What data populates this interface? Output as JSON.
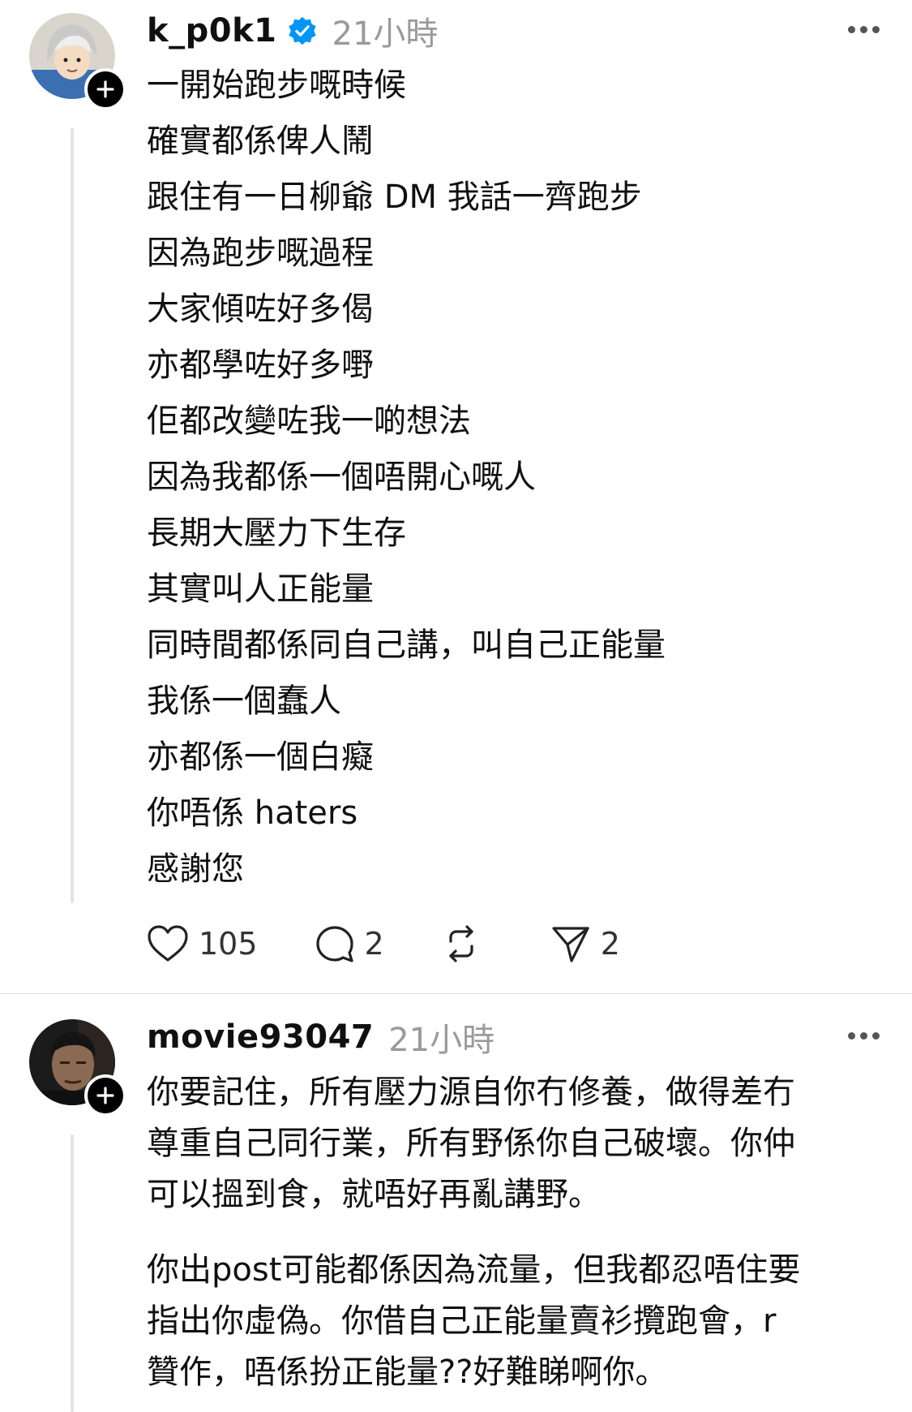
{
  "posts": [
    {
      "username": "k_p0k1",
      "verified": true,
      "time": "21小時",
      "lines": [
        "一開始跑步嘅時候",
        "確實都係俾人鬧",
        "跟住有一日柳爺 DM 我話一齊跑步",
        "因為跑步嘅過程",
        "大家傾咗好多偈",
        "亦都學咗好多嘢",
        "佢都改變咗我一啲想法",
        "因為我都係一個唔開心嘅人",
        "長期大壓力下生存",
        "其實叫人正能量",
        "同時間都係同自己講，叫自己正能量",
        "我係一個蠢人",
        "亦都係一個白癡",
        "你唔係 haters",
        "感謝您"
      ],
      "likes": "105",
      "replies": "2",
      "shares": "2"
    },
    {
      "username": "movie93047",
      "verified": false,
      "time": "21小時",
      "paragraphs": [
        [
          "你要記住，所有壓力源自你冇修養，做得差冇",
          "尊重自己同行業，所有野係你自己破壞。你仲",
          "可以搵到食，就唔好再亂講野。"
        ],
        [
          "你出post可能都係因為流量，但我都忍唔住要",
          "指出你虛偽。你借自己正能量賣衫攬跑會，r",
          "贊作，唔係扮正能量??好難睇啊你。"
        ]
      ]
    }
  ],
  "colors": {
    "text": "#101010",
    "muted": "#9a9a9a",
    "verified_blue": "#0095f6",
    "thread_line": "#e3e3e3"
  },
  "icons": [
    "follow-plus-icon",
    "verified-badge-icon",
    "more-icon",
    "heart-icon",
    "comment-icon",
    "repost-icon",
    "share-icon"
  ]
}
